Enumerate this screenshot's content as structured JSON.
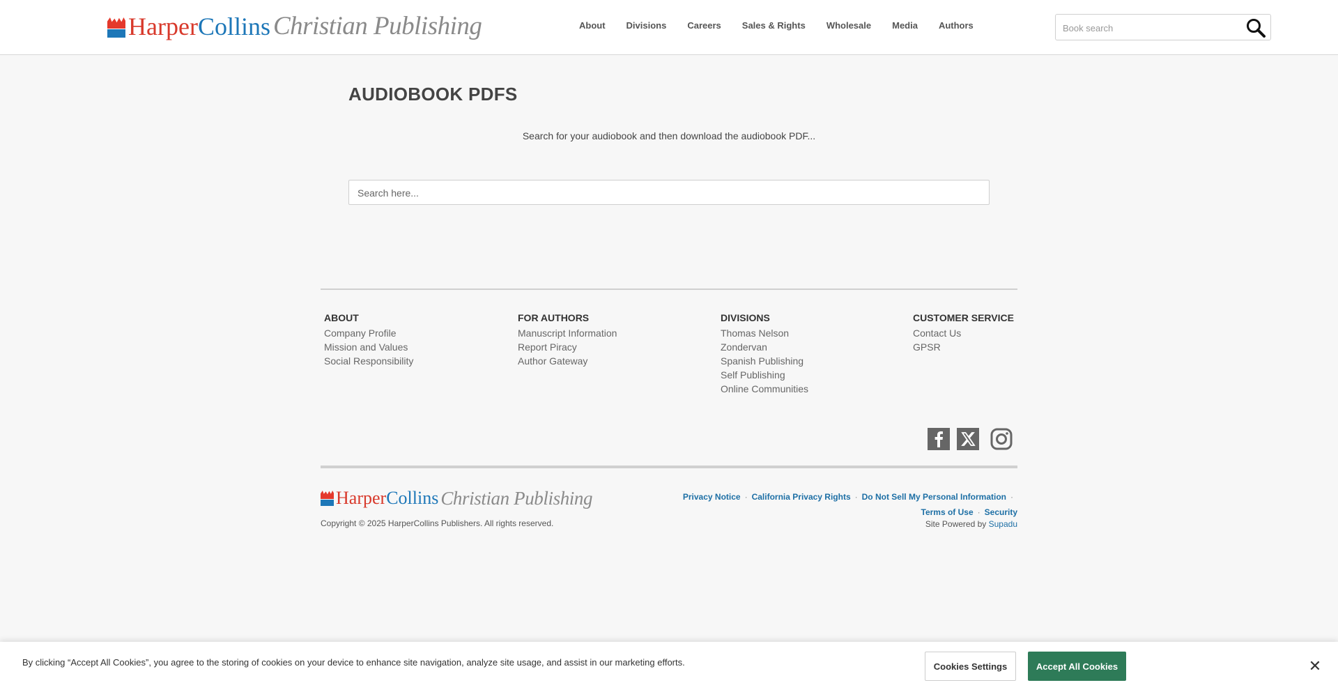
{
  "header": {
    "logo": {
      "harper": "Harper",
      "collins": "Collins",
      "christian_publishing": "Christian Publishing"
    },
    "nav": [
      "About",
      "Divisions",
      "Careers",
      "Sales & Rights",
      "Wholesale",
      "Media",
      "Authors"
    ],
    "search_placeholder": "Book search"
  },
  "main": {
    "title": "AUDIOBOOK PDFS",
    "intro": "Search for your audiobook and then download the audiobook PDF...",
    "search_placeholder": "Search here..."
  },
  "footer": {
    "columns": [
      {
        "heading": "ABOUT",
        "links": [
          "Company Profile",
          "Mission and Values",
          "Social Responsibility"
        ]
      },
      {
        "heading": "FOR AUTHORS",
        "links": [
          "Manuscript Information",
          "Report Piracy",
          "Author Gateway"
        ]
      },
      {
        "heading": "DIVISIONS",
        "links": [
          "Thomas Nelson",
          "Zondervan",
          "Spanish Publishing",
          "Self Publishing",
          "Online Communities"
        ]
      },
      {
        "heading": "CUSTOMER SERVICE",
        "links": [
          "Contact Us",
          "GPSR"
        ]
      }
    ],
    "social_icons": [
      "facebook-icon",
      "x-icon",
      "instagram-icon"
    ],
    "copyright": "Copyright © 2025 HarperCollins Publishers. All rights reserved.",
    "legal_links": [
      "Privacy Notice",
      "California Privacy Rights",
      "Do Not Sell My Personal Information",
      "Terms of Use",
      "Security"
    ],
    "powered_by_label": "Site Powered by",
    "powered_by_link": "Supadu"
  },
  "cookie_banner": {
    "message": "By clicking “Accept All Cookies”, you agree to the storing of cookies on your device to enhance site navigation, analyze site usage, and assist in our marketing efforts.",
    "settings_label": "Cookies Settings",
    "accept_label": "Accept All Cookies",
    "close_icon": "close-icon"
  },
  "colors": {
    "brand_red": "#d8392b",
    "brand_blue": "#1d77b8",
    "link_blue": "#1d6fa5",
    "accept_green": "#2e7b58"
  }
}
